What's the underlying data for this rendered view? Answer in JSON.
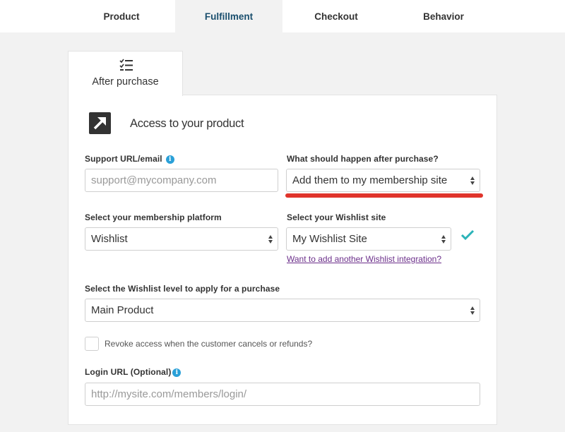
{
  "top_tabs": [
    {
      "label": "Product",
      "active": false
    },
    {
      "label": "Fulfillment",
      "active": true
    },
    {
      "label": "Checkout",
      "active": false
    },
    {
      "label": "Behavior",
      "active": false
    }
  ],
  "subtab": {
    "label": "After purchase",
    "icon": "checklist-icon"
  },
  "section": {
    "title": "Access to your product",
    "icon": "external-link-arrow-icon"
  },
  "support": {
    "label": "Support URL/email",
    "placeholder": "support@mycompany.com",
    "value": "",
    "info_icon": "i"
  },
  "after_purchase": {
    "label": "What should happen after purchase?",
    "value": "Add them to my membership site"
  },
  "platform": {
    "label": "Select your membership platform",
    "value": "Wishlist"
  },
  "wishlist_site": {
    "label": "Select your Wishlist site",
    "value": "My Wishlist Site",
    "add_link": "Want to add another Wishlist integration?"
  },
  "wishlist_level": {
    "label": "Select the Wishlist level to apply for a purchase",
    "value": "Main Product"
  },
  "revoke": {
    "label": "Revoke access when the customer cancels or refunds?",
    "checked": false
  },
  "login": {
    "label": "Login URL (Optional)",
    "placeholder": "http://mysite.com/members/login/",
    "value": "",
    "info_icon": "i"
  },
  "colors": {
    "accent_tab": "#1a4f6e",
    "check": "#2bb3b8",
    "link": "#6b2f8a",
    "underline_highlight": "#e0342b",
    "info": "#2aa0d8"
  }
}
